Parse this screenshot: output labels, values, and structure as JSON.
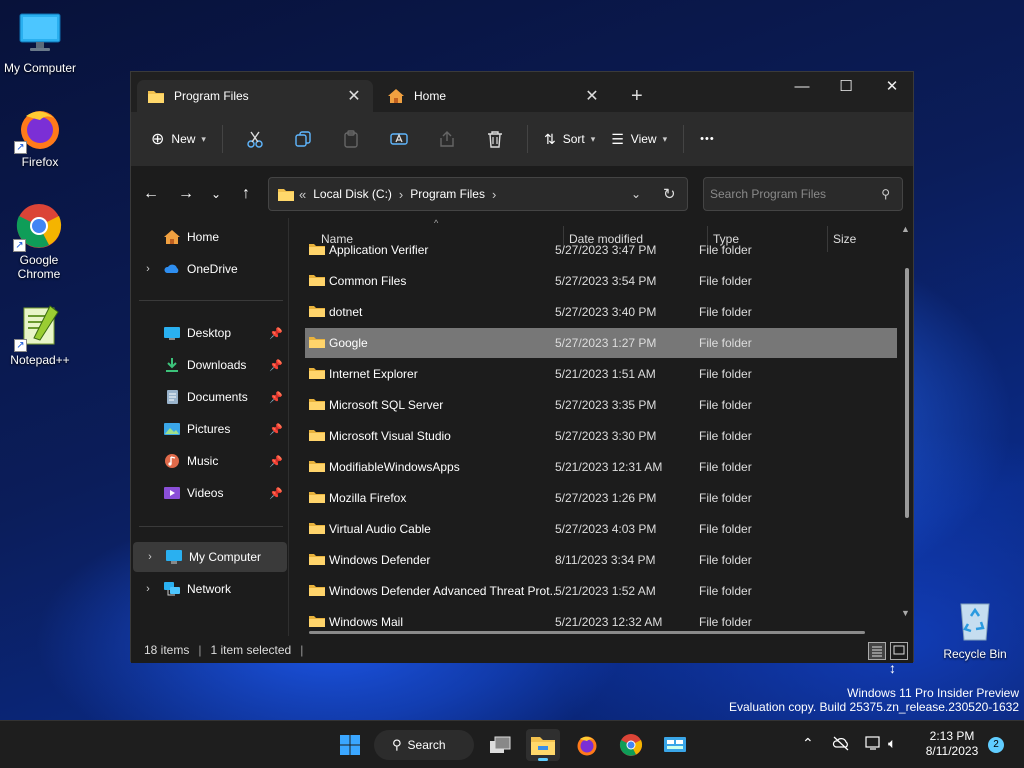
{
  "desktop": {
    "icons": [
      {
        "label": "My Computer"
      },
      {
        "label": "Firefox"
      },
      {
        "label": "Google Chrome"
      },
      {
        "label": "Notepad++"
      },
      {
        "label": "Recycle Bin"
      }
    ],
    "watermark": {
      "line1": "Windows 11 Pro Insider Preview",
      "line2": "Evaluation copy. Build 25375.zn_release.230520-1632"
    }
  },
  "window": {
    "tabs": [
      {
        "label": "Program Files",
        "icon": "folder-icon",
        "active": true
      },
      {
        "label": "Home",
        "icon": "home-icon",
        "active": false
      }
    ],
    "controls": {
      "minimize": "—",
      "maximize": "☐",
      "close": "✕"
    },
    "toolbar": {
      "new_label": "New",
      "sort_label": "Sort",
      "view_label": "View",
      "more_label": "•••"
    },
    "address": {
      "overflow": "«",
      "crumbs": [
        "Local Disk (C:)",
        "Program Files"
      ]
    },
    "search": {
      "placeholder": "Search Program Files"
    },
    "nav_pane": {
      "home": "Home",
      "onedrive": "OneDrive",
      "quick": [
        "Desktop",
        "Downloads",
        "Documents",
        "Pictures",
        "Music",
        "Videos"
      ],
      "my_computer": "My Computer",
      "network": "Network"
    },
    "columns": {
      "name": "Name",
      "date": "Date modified",
      "type": "Type",
      "size": "Size"
    },
    "files": [
      {
        "name": "Application Verifier",
        "date": "5/27/2023 3:47 PM",
        "type": "File folder"
      },
      {
        "name": "Common Files",
        "date": "5/27/2023 3:54 PM",
        "type": "File folder"
      },
      {
        "name": "dotnet",
        "date": "5/27/2023 3:40 PM",
        "type": "File folder"
      },
      {
        "name": "Google",
        "date": "5/27/2023 1:27 PM",
        "type": "File folder",
        "selected": true
      },
      {
        "name": "Internet Explorer",
        "date": "5/21/2023 1:51 AM",
        "type": "File folder"
      },
      {
        "name": "Microsoft SQL Server",
        "date": "5/27/2023 3:35 PM",
        "type": "File folder"
      },
      {
        "name": "Microsoft Visual Studio",
        "date": "5/27/2023 3:30 PM",
        "type": "File folder"
      },
      {
        "name": "ModifiableWindowsApps",
        "date": "5/21/2023 12:31 AM",
        "type": "File folder"
      },
      {
        "name": "Mozilla Firefox",
        "date": "5/27/2023 1:26 PM",
        "type": "File folder"
      },
      {
        "name": "Virtual Audio Cable",
        "date": "5/27/2023 4:03 PM",
        "type": "File folder"
      },
      {
        "name": "Windows Defender",
        "date": "8/11/2023 3:34 PM",
        "type": "File folder"
      },
      {
        "name": "Windows Defender Advanced Threat Prot...",
        "date": "5/21/2023 1:52 AM",
        "type": "File folder"
      },
      {
        "name": "Windows Mail",
        "date": "5/21/2023 12:32 AM",
        "type": "File folder"
      }
    ],
    "status": {
      "items": "18 items",
      "selected": "1 item selected"
    }
  },
  "taskbar": {
    "search_label": "Search",
    "clock_time": "2:13 PM",
    "clock_date": "8/11/2023",
    "notification_count": "2"
  },
  "colors": {
    "accent": "#60cdff",
    "selection": "#777777",
    "folder": "#f2c14e"
  }
}
